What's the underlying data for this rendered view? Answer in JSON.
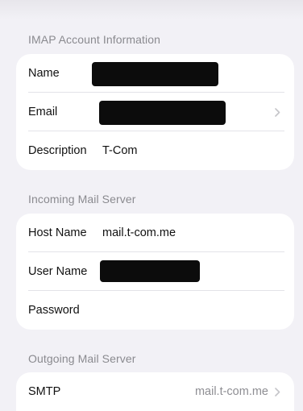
{
  "imap_section": {
    "header": "IMAP Account Information",
    "rows": [
      {
        "label": "Name",
        "value": ""
      },
      {
        "label": "Email",
        "value": ""
      },
      {
        "label": "Description",
        "value": "T-Com"
      }
    ]
  },
  "incoming_section": {
    "header": "Incoming Mail Server",
    "rows": [
      {
        "label": "Host Name",
        "value": "mail.t-com.me"
      },
      {
        "label": "User Name",
        "value": ""
      },
      {
        "label": "Password",
        "value": ""
      }
    ]
  },
  "outgoing_section": {
    "header": "Outgoing Mail Server",
    "rows": [
      {
        "label": "SMTP",
        "value": "mail.t-com.me"
      }
    ]
  },
  "icons": {
    "email_row": "chevron-right-icon",
    "smtp_row": "chevron-right-icon"
  },
  "colors": {
    "background": "#f2f1f6",
    "card": "#ffffff",
    "section_header": "#8a8a8f",
    "secondary_value": "#8e8e93",
    "chevron": "#c5c5c9"
  }
}
